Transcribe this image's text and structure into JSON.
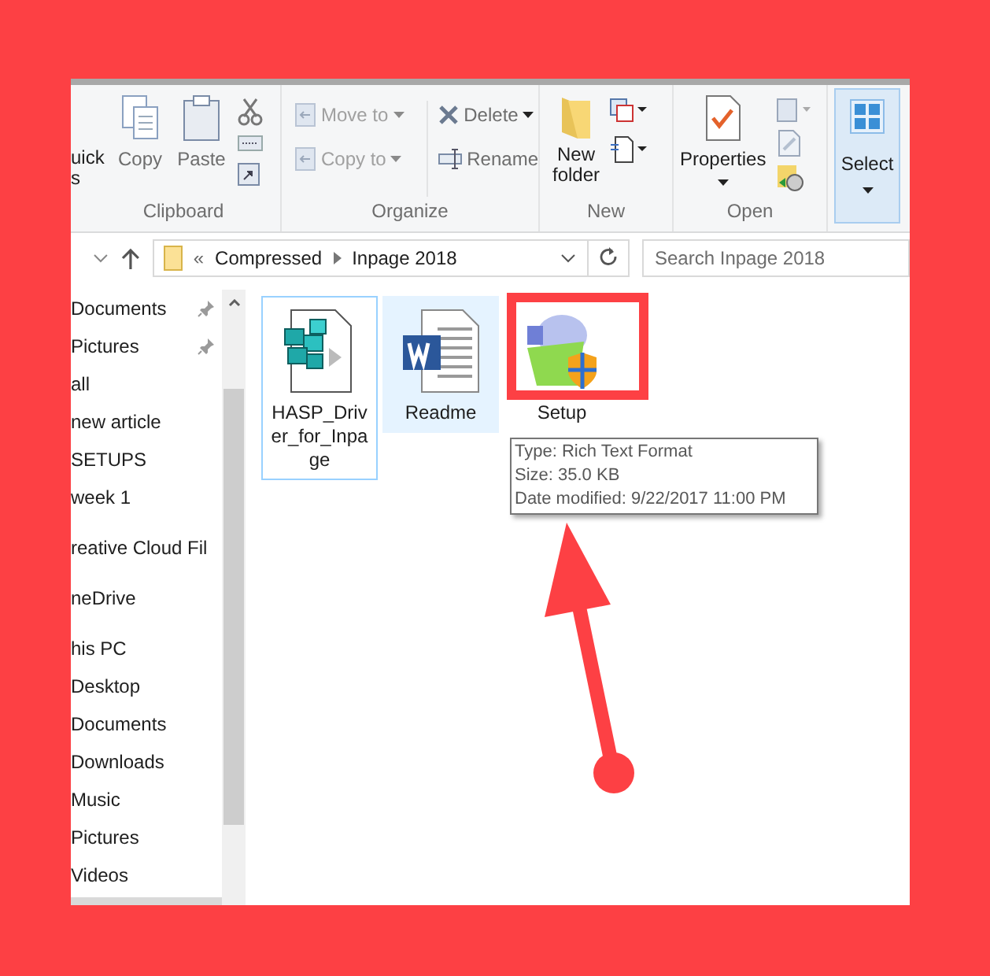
{
  "ribbon": {
    "clipboard": {
      "label": "Clipboard",
      "large_buttons": [
        {
          "lines": [
            "uick",
            "s"
          ]
        },
        {
          "lines": [
            "Copy"
          ]
        },
        {
          "lines": [
            "Paste"
          ]
        }
      ]
    },
    "organize": {
      "label": "Organize",
      "buttons": [
        {
          "label": "Move to",
          "dropdown": true
        },
        {
          "label": "Copy to",
          "dropdown": true
        },
        {
          "label": "Delete",
          "dropdown": true
        },
        {
          "label": "Rename",
          "dropdown": false
        }
      ]
    },
    "new": {
      "label": "New",
      "button": {
        "lines": [
          "New",
          "folder"
        ]
      }
    },
    "open": {
      "label": "Open",
      "button": {
        "label": "Properties",
        "dropdown": true
      }
    },
    "select": {
      "label": "Select",
      "selected": true
    }
  },
  "address_bar": {
    "overflow": "«",
    "path": [
      "Compressed",
      "Inpage 2018"
    ]
  },
  "search": {
    "placeholder": "Search Inpage 2018"
  },
  "navigation": {
    "sections": [
      {
        "items": [
          {
            "label": "Documents",
            "pinned": true
          },
          {
            "label": "Pictures",
            "pinned": true
          },
          {
            "label": "all",
            "pinned": false
          },
          {
            "label": "new article",
            "pinned": false
          },
          {
            "label": "SETUPS",
            "pinned": false
          },
          {
            "label": "week 1",
            "pinned": false
          }
        ]
      },
      {
        "items": [
          {
            "label": "reative Cloud Fil",
            "pinned": false
          }
        ]
      },
      {
        "items": [
          {
            "label": "neDrive",
            "pinned": false
          }
        ]
      },
      {
        "items": [
          {
            "label": "his PC",
            "pinned": false
          },
          {
            "label": "Desktop",
            "pinned": false
          },
          {
            "label": "Documents",
            "pinned": false
          },
          {
            "label": "Downloads",
            "pinned": false
          },
          {
            "label": "Music",
            "pinned": false
          },
          {
            "label": "Pictures",
            "pinned": false
          },
          {
            "label": "Videos",
            "pinned": false
          }
        ]
      }
    ]
  },
  "files": [
    {
      "name": "HASP_Driver_for_Inpage",
      "kind": "registry",
      "selected": true,
      "hovered": false
    },
    {
      "name": "Readme",
      "kind": "word",
      "selected": false,
      "hovered": true
    },
    {
      "name": "Setup",
      "kind": "installer",
      "selected": false,
      "hovered": false
    }
  ],
  "tooltip": {
    "lines": [
      "Type: Rich Text Format",
      "Size: 35.0 KB",
      "Date modified: 9/22/2017 11:00 PM"
    ]
  }
}
